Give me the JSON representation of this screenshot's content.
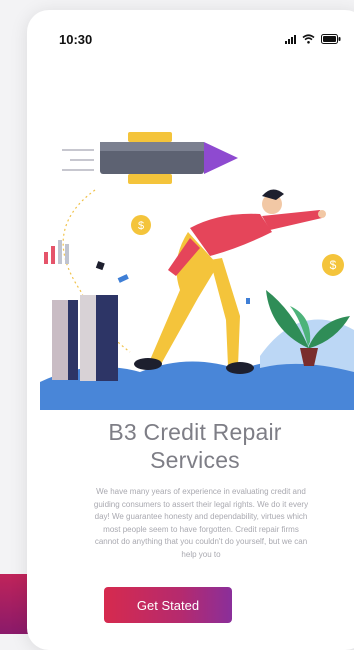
{
  "status_bar": {
    "time": "10:30"
  },
  "onboarding": {
    "title": "B3 Credit Repair Services",
    "body": "We have many years of experience in evaluating credit and guiding consumers to assert their legal rights. We do it every day! We guarantee honesty and dependability, virtues which most people seem to have forgotten. Credit repair firms cannot do anything that you couldn't do yourself, but we can help you to",
    "button_label": "Get Stated"
  },
  "illustration": {
    "icons": [
      "pencil-rocket-icon",
      "coin-icon",
      "coin-icon",
      "bar-chart-icon",
      "plant-icon",
      "buildings-icon"
    ]
  },
  "colors": {
    "accent_start": "#d62a4e",
    "accent_end": "#8a2f9a",
    "title": "#7e7e86",
    "body": "#a9a9b0"
  }
}
